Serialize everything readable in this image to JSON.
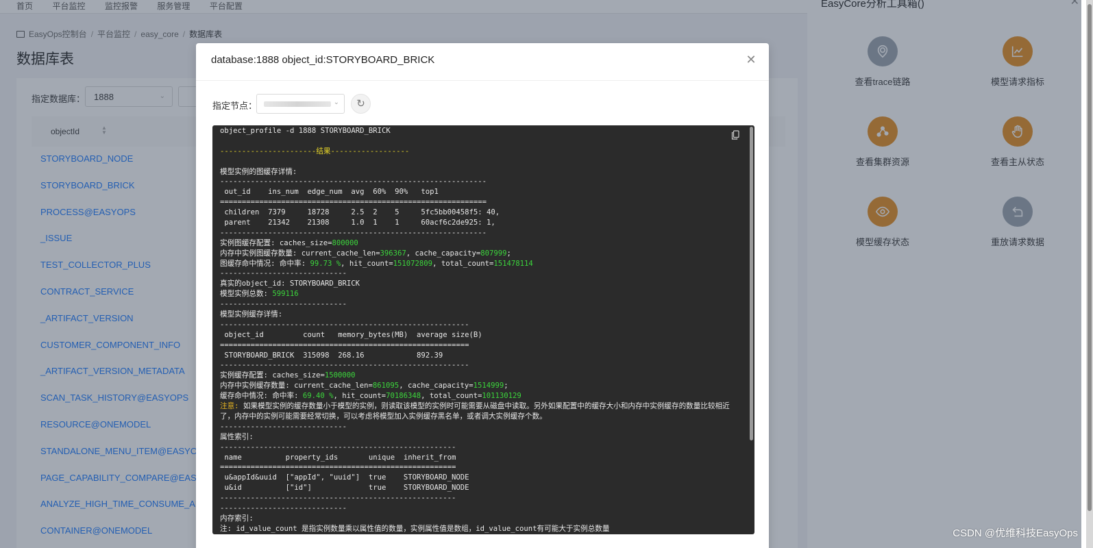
{
  "background": {
    "topnav": [
      "首页",
      "平台监控",
      "监控报警",
      "服务管理",
      "平台配置"
    ],
    "breadcrumb": [
      "EasyOps控制台",
      "平台监控",
      "easy_core",
      "数据库表"
    ],
    "page_title": "数据库表",
    "filter": {
      "label": "指定数据库：",
      "value": "1888"
    },
    "table": {
      "column": "objectId",
      "rows": [
        "STORYBOARD_NODE",
        "STORYBOARD_BRICK",
        "PROCESS@EASYOPS",
        "_ISSUE",
        "TEST_COLLECTOR_PLUS",
        "CONTRACT_SERVICE",
        "_ARTIFACT_VERSION",
        "CUSTOMER_COMPONENT_INFO",
        "_ARTIFACT_VERSION_METADATA",
        "SCAN_TASK_HISTORY@EASYOPS",
        "RESOURCE@ONEMODEL",
        "STANDALONE_MENU_ITEM@EASYOPS",
        "PAGE_CAPABILITY_COMPARE@EASYOPS",
        "ANALYZE_HIGH_TIME_CONSUME_API",
        "CONTAINER@ONEMODEL"
      ]
    }
  },
  "drawer": {
    "title": "EasyCore分析工具箱()",
    "ops": [
      {
        "label": "查看trace链路",
        "icon": "trace-icon",
        "color": "#9aa3ad"
      },
      {
        "label": "模型请求指标",
        "icon": "line-chart-icon",
        "color": "#e58c1e"
      },
      {
        "label": "查看集群资源",
        "icon": "cluster-icon",
        "color": "#e58c1e"
      },
      {
        "label": "查看主从状态",
        "icon": "hand-icon",
        "color": "#e58c1e"
      },
      {
        "label": "模型缓存状态",
        "icon": "eye-icon",
        "color": "#e58c1e"
      },
      {
        "label": "重放请求数据",
        "icon": "replay-icon",
        "color": "#9aa3ad"
      }
    ]
  },
  "modal": {
    "title": "database:1888 object_id:STORYBOARD_BRICK",
    "node_label": "指定节点：",
    "terminal": {
      "command": "object_profile -d 1888 STORYBOARD_BRICK",
      "result_banner": "----------------------结果------------------",
      "graph_title": "模型实例的图缓存详情:",
      "sep_long": "-------------------------------------------------------------",
      "sep_eq": "=============================================================",
      "graph_header": " out_id    ins_num  edge_num  avg  60%  90%   top1",
      "graph_row1": " children  7379     18728     2.5  2    5     5fc5bb00458f5: 40,",
      "graph_row2": " parent    21342    21308     1.0  1    1     60acf6c2de925: 1,",
      "graph_cache_label": "实例图缓存配置: caches_size=",
      "graph_cache_value": "800000",
      "graph_mem_label": "内存中实例图缓存数量: current_cache_len=",
      "graph_mem_len": "396367",
      "graph_mem_cap_label": ", cache_capacity=",
      "graph_mem_cap": "807999",
      "graph_hit_label": "图缓存命中情况: 命中率: ",
      "graph_hit_rate": "99.73 %",
      "graph_hit_count_label": ", hit_count=",
      "graph_hit_count": "151072809",
      "graph_total_label": ", total_count=",
      "graph_total": "151478114",
      "sep_short": "-----------------------------",
      "real_id": "真实的object_id: STORYBOARD_BRICK",
      "ins_total_label": "模型实例总数: ",
      "ins_total": "599116",
      "ins_cache_title": "模型实例缓存详情:",
      "sep_mid": "---------------------------------------------------------",
      "ins_header": " object_id         count   memory_bytes(MB)  average size(B)",
      "sep_mid_eq": "=========================================================",
      "ins_row": " STORYBOARD_BRICK  315098  268.16            892.39",
      "ins_cache_label": "实例缓存配置: caches_size=",
      "ins_cache_value": "1500000",
      "ins_mem_label": "内存中实例缓存数量: current_cache_len=",
      "ins_mem_len": "861095",
      "ins_mem_cap_label": ", cache_capacity=",
      "ins_mem_cap": "1514999",
      "ins_hit_label": "缓存命中情况: 命中率: ",
      "ins_hit_rate": "69.40 %",
      "ins_hit_count_label": ", hit_count=",
      "ins_hit_count": "70186348",
      "ins_total_count_label": ", total_count=",
      "ins_total_count": "101130129",
      "note_label": "注意:",
      "note_text": " 如果模型实例的缓存数量小于模型的实例，则读取该模型的实例时可能需要从磁盘中读取。另外如果配置中的缓存大小和内存中实例缓存的数量比较相近了，内存中的实例可能需要经常切换，可以考虑将模型加入实例缓存黑名单，或者调大实例缓存个数。",
      "attr_title": "属性索引:",
      "sep_attr": "------------------------------------------------------",
      "attr_header": " name          property_ids       unique  inherit_from",
      "sep_attr_eq": "======================================================",
      "attr_row1": " u&appId&uuid  [\"appId\", \"uuid\"]  true    STORYBOARD_NODE",
      "attr_row2": " u&id          [\"id\"]             true    STORYBOARD_NODE",
      "mem_index_title": "内存索引:",
      "mem_index_note": "注: id_value_count 是指实例数量乘以属性值的数量，实例属性值是数组，id_value_count有可能大于实例总数量"
    }
  },
  "watermark": "CSDN @优维科技EasyOps"
}
